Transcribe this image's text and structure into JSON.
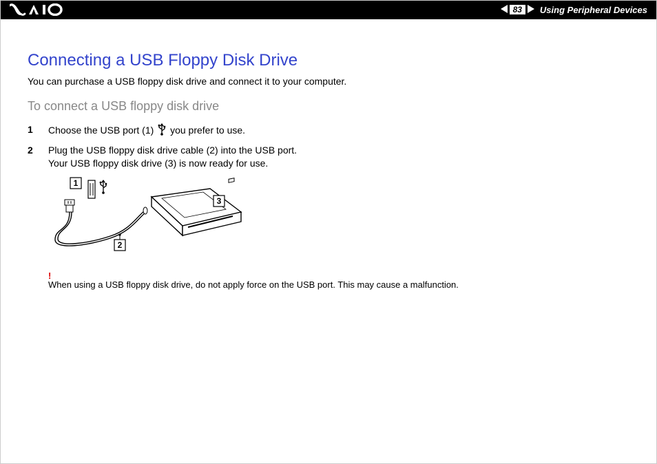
{
  "header": {
    "logo_alt": "VAIO",
    "page_number": "83",
    "section": "Using Peripheral Devices"
  },
  "title": "Connecting a USB Floppy Disk Drive",
  "intro": "You can purchase a USB floppy disk drive and connect it to your computer.",
  "subtitle": "To connect a USB floppy disk drive",
  "steps": [
    {
      "num": "1",
      "text_before_icon": "Choose the USB port (1) ",
      "text_after_icon": " you prefer to use."
    },
    {
      "num": "2",
      "line1": "Plug the USB floppy disk drive cable (2) into the USB port.",
      "line2": "Your USB floppy disk drive (3) is now ready for use."
    }
  ],
  "diagram": {
    "callouts": [
      "1",
      "2",
      "3"
    ]
  },
  "warning": {
    "mark": "!",
    "text": "When using a USB floppy disk drive, do not apply force on the USB port. This may cause a malfunction."
  }
}
